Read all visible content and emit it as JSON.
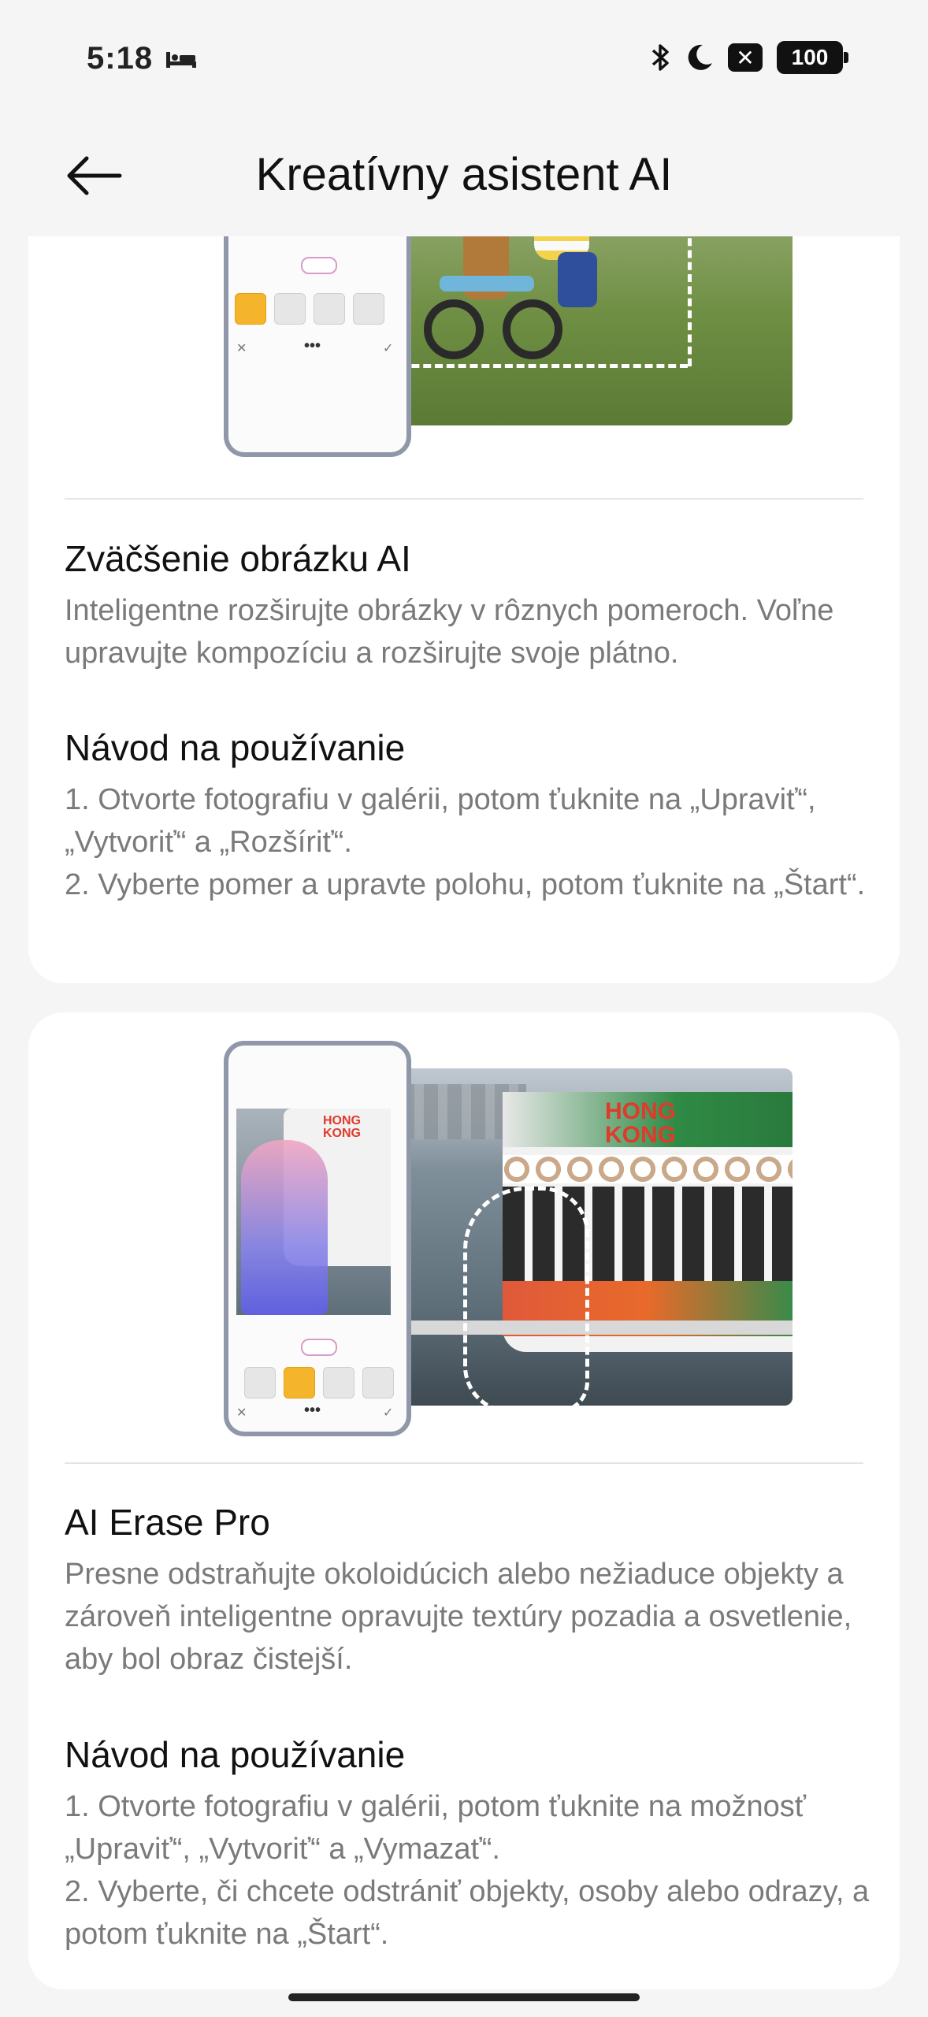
{
  "status_bar": {
    "time": "5:18",
    "battery": "100",
    "x_badge": "✕"
  },
  "header": {
    "title": "Kreatívny asistent AI"
  },
  "feature1": {
    "title": "Zväčšenie obrázku AI",
    "description": "Inteligentne rozširujte obrázky v rôznych pomeroch. Voľne upravujte kompozíciu a rozširujte svoje plátno.",
    "howto_title": "Návod na používanie",
    "steps": [
      "1. Otvorte fotografiu v galérii, potom ťuknite na „Upraviť“, „Vytvoriť“ a „Rozšíriť“.",
      "2. Vyberte pomer a upravte polohu, potom ťuknite na „Štart“."
    ]
  },
  "feature2": {
    "title": "AI Erase Pro",
    "description": "Presne odstraňujte okoloidúcich alebo nežiaduce objekty a zároveň inteligentne opravujte textúry pozadia a osvetlenie, aby bol obraz čistejší.",
    "howto_title": "Návod na používanie",
    "steps": [
      "1. Otvorte fotografiu v galérii, potom ťuknite na možnosť „Upraviť“, „Vytvoriť“ a „Vymazať“.",
      "2. Vyberte, či chcete odstrániť objekty, osoby alebo odrazy, a potom ťuknite na „Štart“."
    ],
    "ferry_sign": [
      "HONG",
      "KONG"
    ]
  },
  "icons": [
    "back-arrow-icon",
    "bed-icon",
    "bluetooth-icon",
    "moon-icon",
    "battery-icon"
  ],
  "colors": {
    "accent": "#f4b52c",
    "background": "#f5f5f5",
    "card": "#ffffff",
    "secondary_text": "#7a7a7a"
  }
}
